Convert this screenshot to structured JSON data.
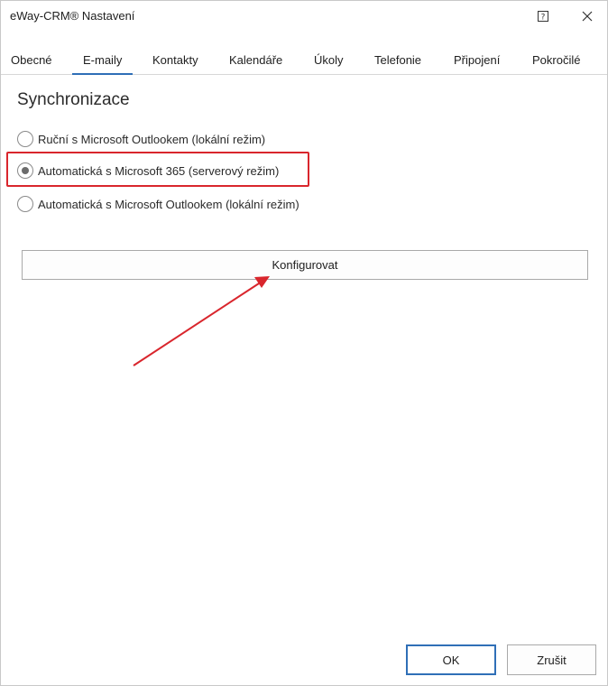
{
  "window": {
    "title": "eWay-CRM® Nastavení"
  },
  "tabs": [
    {
      "label": "Obecné",
      "active": false
    },
    {
      "label": "E-maily",
      "active": true
    },
    {
      "label": "Kontakty",
      "active": false
    },
    {
      "label": "Kalendáře",
      "active": false
    },
    {
      "label": "Úkoly",
      "active": false
    },
    {
      "label": "Telefonie",
      "active": false
    },
    {
      "label": "Připojení",
      "active": false
    },
    {
      "label": "Pokročilé",
      "active": false
    }
  ],
  "sync": {
    "heading": "Synchronizace",
    "options": [
      {
        "label": "Ruční s Microsoft Outlookem (lokální režim)",
        "selected": false
      },
      {
        "label": "Automatická s Microsoft 365 (serverový režim)",
        "selected": true
      },
      {
        "label": "Automatická s Microsoft Outlookem (lokální režim)",
        "selected": false
      }
    ],
    "configure_label": "Konfigurovat"
  },
  "footer": {
    "ok_label": "OK",
    "cancel_label": "Zrušit"
  },
  "colors": {
    "accent": "#2f6fb7",
    "annotation_red": "#d9262d"
  }
}
